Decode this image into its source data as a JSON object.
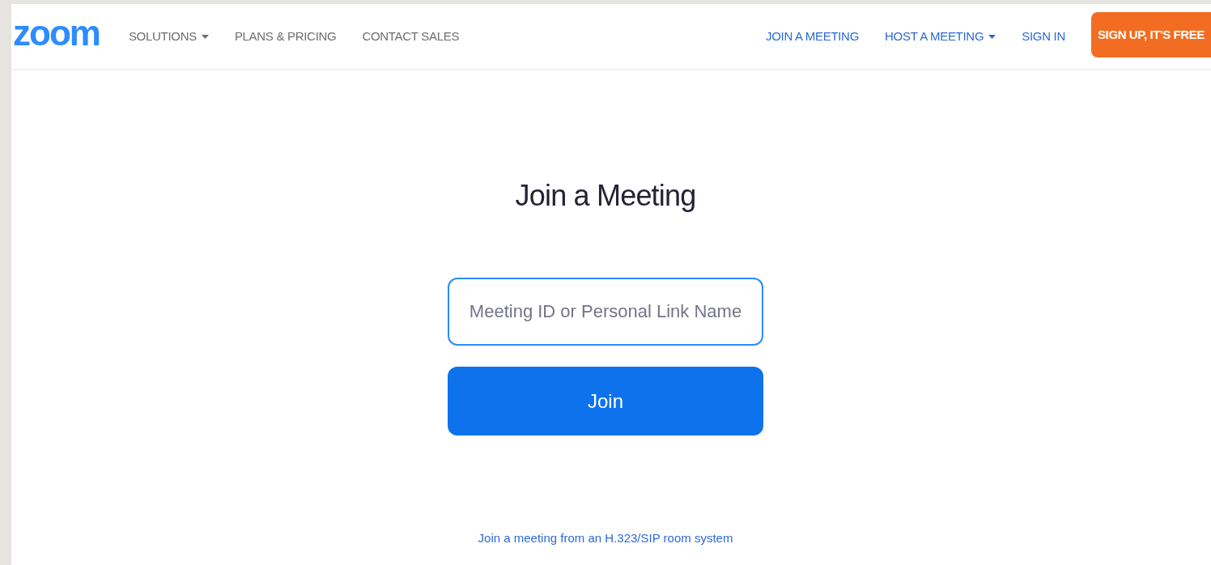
{
  "header": {
    "logo": "zoom",
    "nav_left": [
      {
        "label": "SOLUTIONS",
        "has_menu": true
      },
      {
        "label": "PLANS & PRICING",
        "has_menu": false
      },
      {
        "label": "CONTACT SALES",
        "has_menu": false
      }
    ],
    "nav_right": [
      {
        "label": "JOIN A MEETING",
        "has_menu": false
      },
      {
        "label": "HOST A MEETING",
        "has_menu": true
      },
      {
        "label": "SIGN IN",
        "has_menu": false
      }
    ],
    "signup_button": "SIGN UP, IT'S FREE"
  },
  "main": {
    "title": "Join a Meeting",
    "meeting_field": {
      "placeholder": "Meeting ID or Personal Link Name",
      "focused": true
    },
    "join_button": "Join",
    "room_system_link": "Join a meeting from an H.323/SIP room system"
  }
}
